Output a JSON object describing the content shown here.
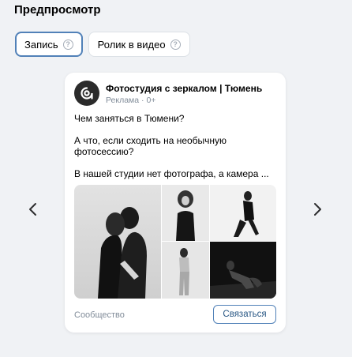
{
  "preview": {
    "title": "Предпросмотр",
    "tabs": [
      {
        "label": "Запись",
        "active": true,
        "help_icon": "question-circle-icon"
      },
      {
        "label": "Ролик в видео",
        "active": false,
        "help_icon": "question-circle-icon"
      }
    ]
  },
  "carousel": {
    "prev_icon": "chevron-left-icon",
    "next_icon": "chevron-right-icon"
  },
  "post": {
    "avatar_icon": "brand-logo-icon",
    "author": "Фотостудия с зеркалом | Тюмень",
    "meta": "Реклама · 0+",
    "paragraphs": [
      "Чем заняться в Тюмени?",
      "А что, если сходить на необычную фотосессию?",
      "В нашей студии нет фотографа, а камера ..."
    ],
    "photos": [
      "photo-couple-kissing",
      "photo-woman-standing-curly-hair",
      "photo-woman-posing-dark-outfit",
      "photo-woman-sitting-light-pants",
      "photo-woman-kneeling-dark-background"
    ],
    "footer_label": "Сообщество",
    "cta_label": "Связаться"
  },
  "colors": {
    "background": "#f0f2f5",
    "accent": "#5181b8",
    "link": "#2a5885",
    "secondary_text": "#818c99"
  }
}
